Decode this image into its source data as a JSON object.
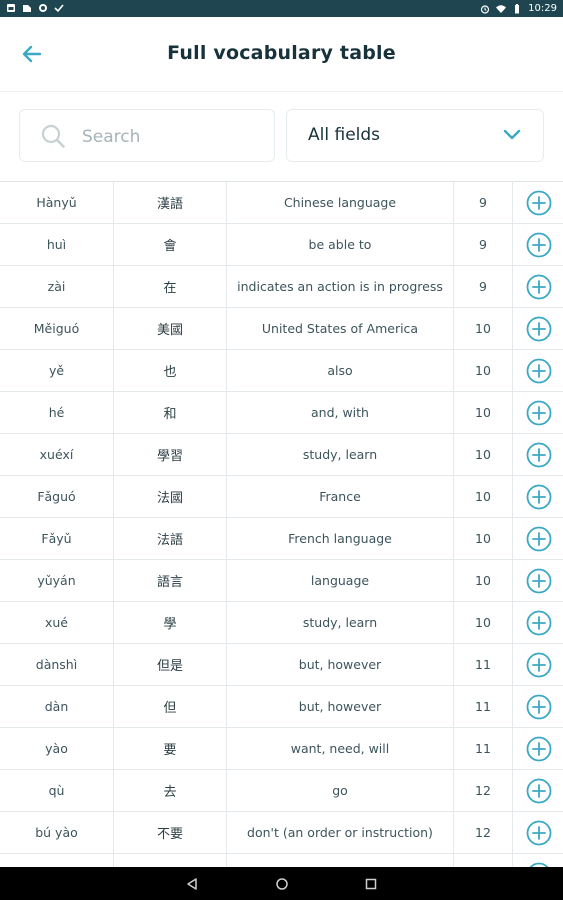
{
  "status_bar": {
    "time": "10:29"
  },
  "header": {
    "title": "Full vocabulary table"
  },
  "search": {
    "placeholder": "Search",
    "value": ""
  },
  "filter": {
    "selected": "All fields"
  },
  "colors": {
    "accent": "#3aa9c4",
    "title": "#17323b",
    "status_bar": "#1f4650"
  },
  "table": {
    "rows": [
      {
        "pinyin": "Hànyǔ",
        "hanzi": "漢語",
        "english": "Chinese language",
        "lesson": "9"
      },
      {
        "pinyin": "huì",
        "hanzi": "會",
        "english": "be able to",
        "lesson": "9"
      },
      {
        "pinyin": "zài",
        "hanzi": "在",
        "english": "indicates an action is in progress",
        "lesson": "9"
      },
      {
        "pinyin": "Měiguó",
        "hanzi": "美國",
        "english": "United States of America",
        "lesson": "10"
      },
      {
        "pinyin": "yě",
        "hanzi": "也",
        "english": "also",
        "lesson": "10"
      },
      {
        "pinyin": "hé",
        "hanzi": "和",
        "english": "and, with",
        "lesson": "10"
      },
      {
        "pinyin": "xuéxí",
        "hanzi": "學習",
        "english": "study, learn",
        "lesson": "10"
      },
      {
        "pinyin": "Fǎguó",
        "hanzi": "法國",
        "english": "France",
        "lesson": "10"
      },
      {
        "pinyin": "Fǎyǔ",
        "hanzi": "法語",
        "english": "French language",
        "lesson": "10"
      },
      {
        "pinyin": "yǔyán",
        "hanzi": "語言",
        "english": "language",
        "lesson": "10"
      },
      {
        "pinyin": "xué",
        "hanzi": "學",
        "english": "study, learn",
        "lesson": "10"
      },
      {
        "pinyin": "dànshì",
        "hanzi": "但是",
        "english": "but, however",
        "lesson": "11"
      },
      {
        "pinyin": "dàn",
        "hanzi": "但",
        "english": "but, however",
        "lesson": "11"
      },
      {
        "pinyin": "yào",
        "hanzi": "要",
        "english": "want, need, will",
        "lesson": "11"
      },
      {
        "pinyin": "qù",
        "hanzi": "去",
        "english": "go",
        "lesson": "12"
      },
      {
        "pinyin": "bú yào",
        "hanzi": "不要",
        "english": "don't (an order or instruction)",
        "lesson": "12"
      },
      {
        "pinyin": "",
        "hanzi": "",
        "english": "",
        "lesson": ""
      }
    ]
  },
  "icons": {
    "back": "arrow-left-icon",
    "search": "search-icon",
    "dropdown": "chevron-down-icon",
    "add": "plus-circle-icon"
  }
}
